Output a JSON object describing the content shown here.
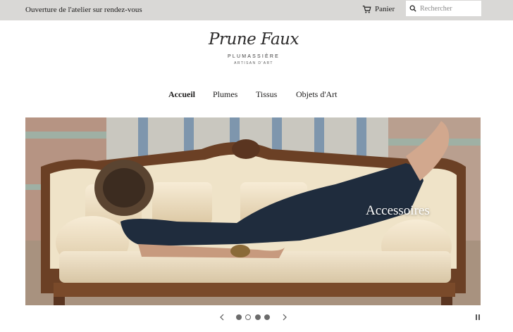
{
  "announcement": {
    "text": "Ouverture de l'atelier sur rendez-vous"
  },
  "header": {
    "cart_label": "Panier",
    "cart_icon": "cart-icon",
    "search_icon": "search-icon",
    "search_placeholder": "Rechercher"
  },
  "logo": {
    "script": "Prune Faux",
    "subtitle": "PLUMASSIÈRE",
    "tagline": "ARTISAN D'ART"
  },
  "nav": {
    "items": [
      {
        "label": "Accueil",
        "active": true
      },
      {
        "label": "Plumes",
        "active": false
      },
      {
        "label": "Tissus",
        "active": false
      },
      {
        "label": "Objets d'Art",
        "active": false
      }
    ]
  },
  "slideshow": {
    "caption": "Accessoires",
    "slide_count": 4,
    "active_slide": 2,
    "prev_icon": "chevron-left-icon",
    "next_icon": "chevron-right-icon",
    "pause_icon": "pause-icon"
  },
  "colors": {
    "topbar": "#d9d8d6",
    "text": "#1c1b1b",
    "dot": "#6b6b6b"
  }
}
